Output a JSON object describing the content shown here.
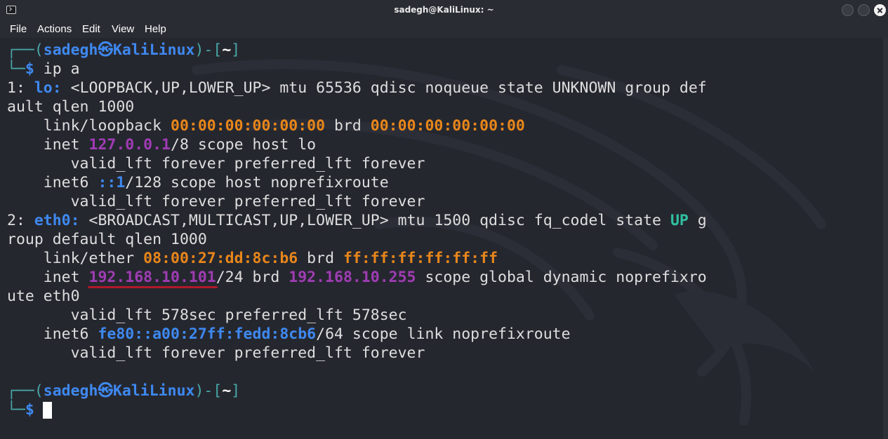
{
  "window": {
    "title": "sadegh@KaliLinux: ~"
  },
  "menu": {
    "file": "File",
    "actions": "Actions",
    "edit": "Edit",
    "view": "View",
    "help": "Help"
  },
  "prompt": {
    "top_left": "┌──(",
    "user": "sadegh",
    "at": "㉿",
    "host": "KaliLinux",
    "mid": ")-[",
    "path": "~",
    "end": "]",
    "bottom": "└─",
    "dollar": "$"
  },
  "command": "ip a",
  "output": {
    "lo_index": "1: ",
    "lo_name": "lo:",
    "lo_flags_1": " <LOOPBACK,UP,LOWER_UP> mtu 65536 qdisc noqueue state UNKNOWN group def",
    "lo_flags_2": "ault qlen 1000",
    "lo_link_label": "    link/loopback ",
    "lo_mac": "00:00:00:00:00:00",
    "brd_label": " brd ",
    "lo_brd": "00:00:00:00:00:00",
    "inet_label": "    inet ",
    "lo_ip4": "127.0.0.1",
    "lo_ip4_rest": "/8 scope host lo",
    "valid_forever": "       valid_lft forever preferred_lft forever",
    "inet6_label": "    inet6 ",
    "lo_ip6": "::1",
    "lo_ip6_rest": "/128 scope host noprefixroute",
    "eth_index": "2: ",
    "eth_name": "eth0:",
    "eth_flags_1": " <BROADCAST,MULTICAST,UP,LOWER_UP> mtu 1500 qdisc fq_codel state ",
    "eth_state": "UP",
    "eth_flags_1_end": " g",
    "eth_flags_2": "roup default qlen 1000",
    "eth_link_label": "    link/ether ",
    "eth_mac": "08:00:27:dd:8c:b6",
    "eth_brd_mac": "ff:ff:ff:ff:ff:ff",
    "eth_ip4": "192.168.10.101",
    "eth_ip4_mid": "/24 brd ",
    "eth_brd_ip": "192.168.10.255",
    "eth_ip4_rest": " scope global dynamic noprefixro",
    "eth_ip4_wrap": "ute eth0",
    "eth_valid": "       valid_lft 578sec preferred_lft 578sec",
    "eth_ip6": "fe80::a00:27ff:fedd:8cb6",
    "eth_ip6_rest": "/64 scope link noprefixroute"
  },
  "colors": {
    "background": "#25272f",
    "prompt_tree": "#48a8a8",
    "prompt_user": "#3e89f0",
    "mac_address": "#e8861a",
    "ipv4_address": "#a03cb4",
    "state_up": "#30c0a0",
    "highlight_underline": "#b0192a"
  }
}
